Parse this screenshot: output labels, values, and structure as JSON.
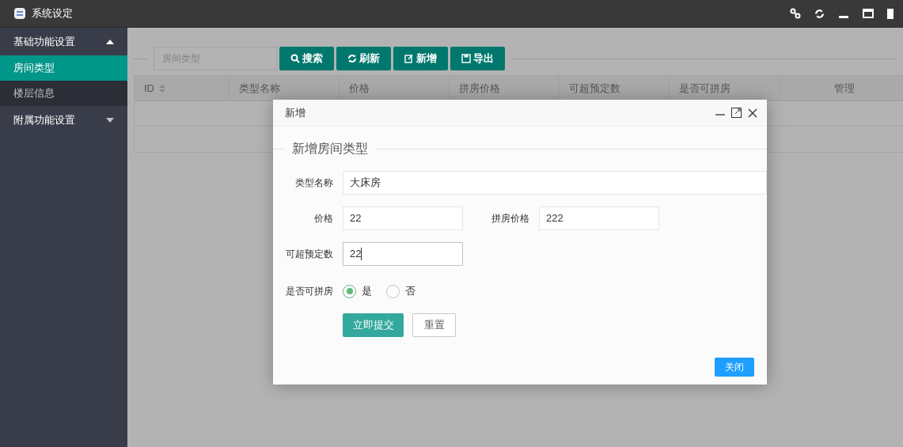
{
  "window": {
    "title": "系统设定"
  },
  "sidebar": {
    "groups": [
      {
        "label": "基础功能设置",
        "expanded": true,
        "items": [
          {
            "label": "房间类型",
            "selected": true
          },
          {
            "label": "楼层信息",
            "selected": false
          }
        ]
      },
      {
        "label": "附属功能设置",
        "expanded": false
      }
    ]
  },
  "toolbar": {
    "search": {
      "placeholder": "房间类型"
    },
    "buttons": [
      {
        "label": "搜索",
        "kind": "search"
      },
      {
        "label": "刷新",
        "kind": "refresh"
      },
      {
        "label": "新增",
        "kind": "add"
      },
      {
        "label": "导出",
        "kind": "export"
      }
    ]
  },
  "table": {
    "columns": [
      {
        "label": "ID",
        "sortable": true
      },
      {
        "label": "类型名称",
        "sortable": false
      },
      {
        "label": "价格",
        "sortable": false
      },
      {
        "label": "拼房价格",
        "sortable": false
      },
      {
        "label": "可超预定数",
        "sortable": false
      },
      {
        "label": "是否可拼房",
        "sortable": false
      },
      {
        "label": "管理",
        "sortable": false
      }
    ]
  },
  "dialog": {
    "title": "新增",
    "legend": "新增房间类型",
    "fields": [
      {
        "label": "类型名称",
        "value": "大床房",
        "kind": "wide"
      },
      {
        "label": "价格",
        "value": "22",
        "kind": "half"
      },
      {
        "label": "拼房价格",
        "value": "222",
        "kind": "half"
      },
      {
        "label": "可超预定数",
        "value": "22",
        "kind": "focused"
      }
    ],
    "radio": {
      "label": "是否可拼房",
      "options": [
        {
          "label": "是",
          "selected": true
        },
        {
          "label": "否",
          "selected": false
        }
      ]
    },
    "submit": "立即提交",
    "reset": "重置",
    "close": "关闭"
  }
}
